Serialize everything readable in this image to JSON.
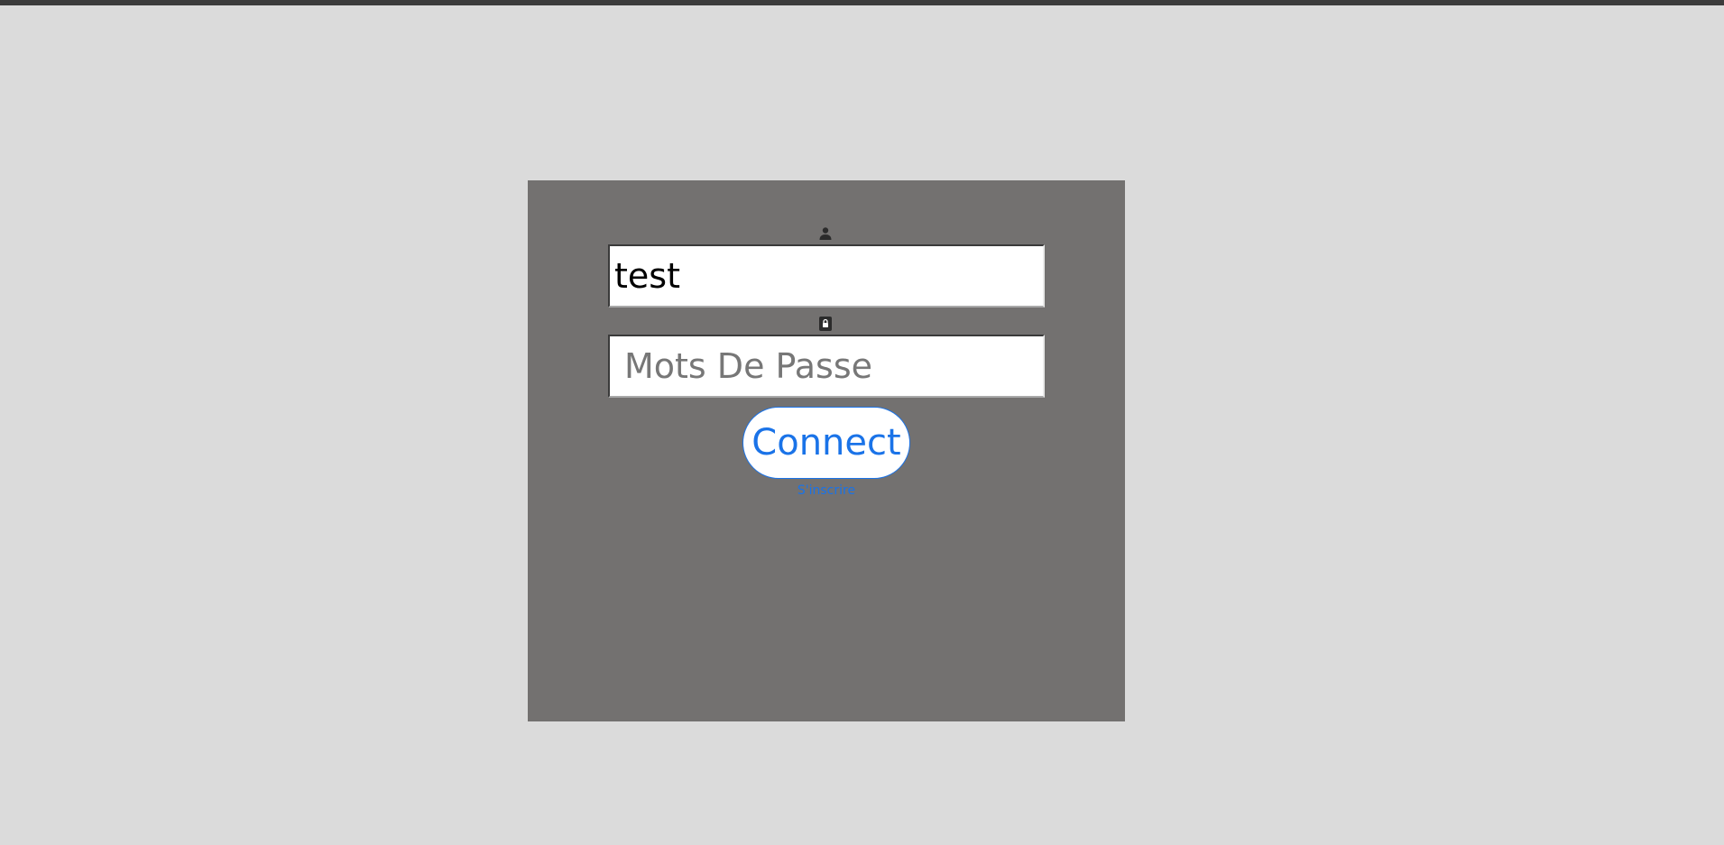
{
  "colors": {
    "page_background": "#dbdbdb",
    "top_strip": "#3c3c3c",
    "panel_background": "#737170",
    "accent": "#1a73e8",
    "icon_color": "#2b2b2b"
  },
  "login": {
    "username": {
      "icon": "user-icon",
      "value": "test"
    },
    "password": {
      "icon": "lock-icon",
      "value": "",
      "placeholder": "Mots De Passe"
    },
    "connect_label": "Connect",
    "register_label": "S'inscrire"
  }
}
